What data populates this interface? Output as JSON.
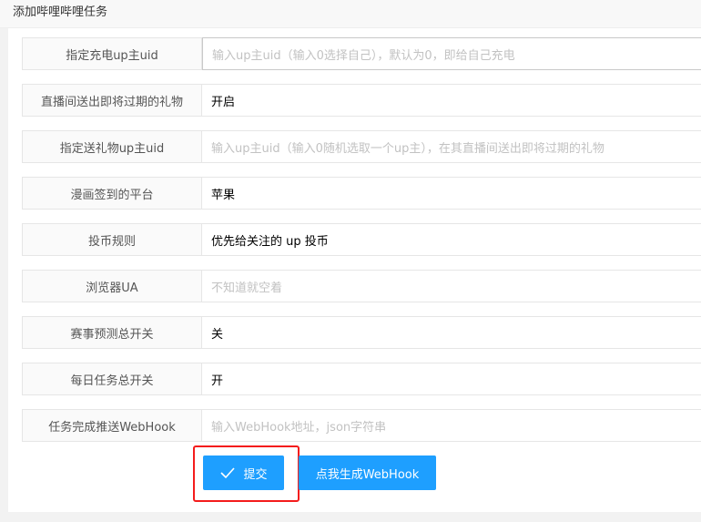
{
  "title": "添加哔哩哔哩任务",
  "fields": [
    {
      "label": "指定充电up主uid",
      "value": "",
      "placeholder": "输入up主uid（输入0选择自己），默认为0，即给自己充电"
    },
    {
      "label": "直播间送出即将过期的礼物",
      "value": "开启",
      "placeholder": ""
    },
    {
      "label": "指定送礼物up主uid",
      "value": "",
      "placeholder": "输入up主uid（输入0随机选取一个up主），在其直播间送出即将过期的礼物"
    },
    {
      "label": "漫画签到的平台",
      "value": "苹果",
      "placeholder": ""
    },
    {
      "label": "投币规则",
      "value": "优先给关注的 up 投币",
      "placeholder": ""
    },
    {
      "label": "浏览器UA",
      "value": "",
      "placeholder": "不知道就空着"
    },
    {
      "label": "赛事预测总开关",
      "value": "关",
      "placeholder": ""
    },
    {
      "label": "每日任务总开关",
      "value": "开",
      "placeholder": ""
    },
    {
      "label": "任务完成推送WebHook",
      "value": "",
      "placeholder": "输入WebHook地址，json字符串"
    }
  ],
  "buttons": {
    "submit": "提交",
    "webhook": "点我生成WebHook"
  },
  "colors": {
    "primary": "#1e9fff",
    "highlight": "#f41c1c"
  }
}
